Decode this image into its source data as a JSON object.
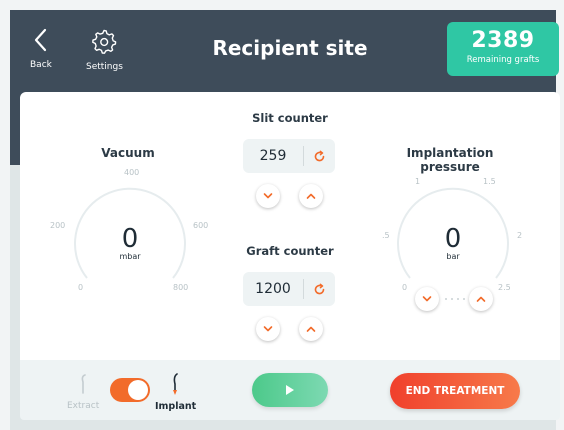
{
  "header": {
    "back_label": "Back",
    "settings_label": "Settings",
    "title": "Recipient site",
    "remaining_value": "2389",
    "remaining_label": "Remaining grafts"
  },
  "vacuum": {
    "title": "Vacuum",
    "value": "0",
    "unit": "mbar",
    "ticks": [
      "0",
      "200",
      "400",
      "600",
      "800"
    ]
  },
  "slit_counter": {
    "title": "Slit counter",
    "value": "259"
  },
  "graft_counter": {
    "title": "Graft counter",
    "value": "1200"
  },
  "pressure": {
    "title": "Implantation pressure",
    "value": "0",
    "unit": "bar",
    "ticks": [
      ".5",
      "1",
      "1.5",
      "2",
      "2.5",
      "0"
    ]
  },
  "bottom": {
    "extract_label": "Extract",
    "implant_label": "Implant",
    "end_label": "END TREATMENT"
  },
  "colors": {
    "header_bg": "#3e4c5a",
    "accent_green": "#2fc7a4",
    "accent_orange": "#f26b2a",
    "danger": "#f0402c"
  },
  "icons": {
    "back": "chevron-left-icon",
    "settings": "gear-icon",
    "reset": "refresh-icon",
    "down": "chevron-down-icon",
    "up": "chevron-up-icon",
    "play": "play-icon",
    "extract_tool": "extract-tool-icon",
    "implant_tool": "implant-tool-icon"
  }
}
